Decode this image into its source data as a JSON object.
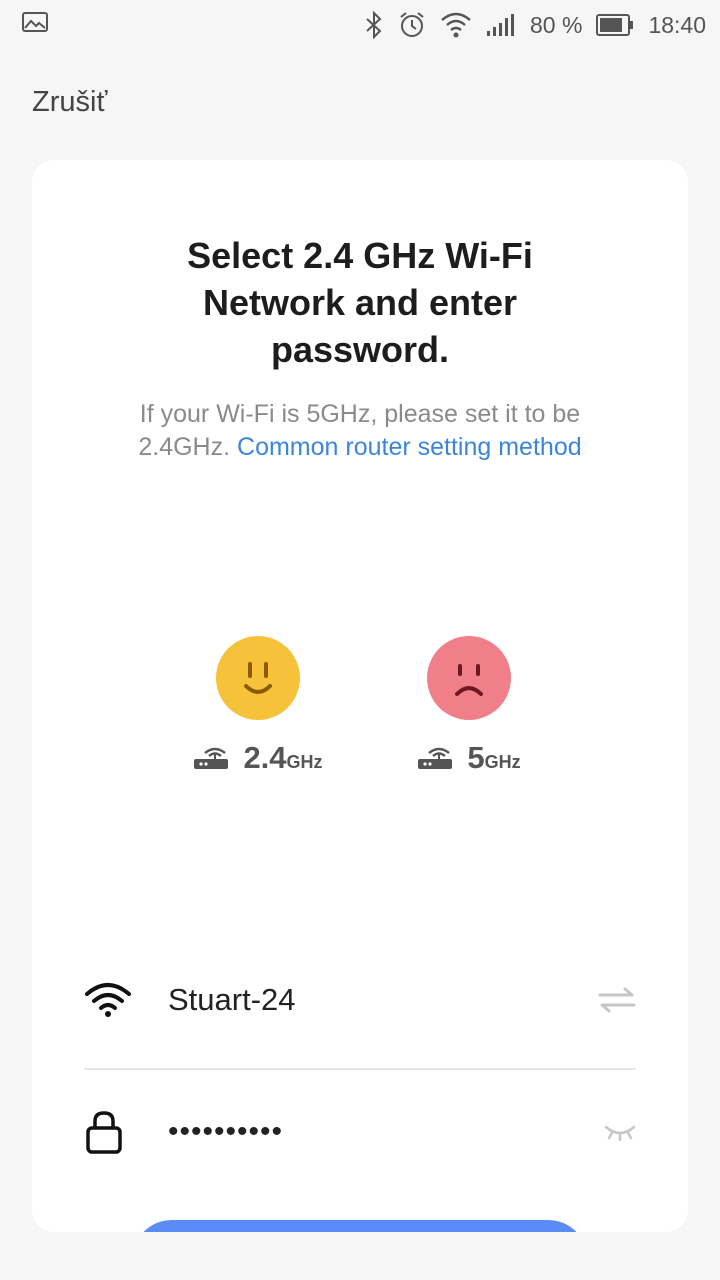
{
  "status_bar": {
    "battery_percent": "80 %",
    "time": "18:40",
    "icons": [
      "image-icon",
      "bluetooth-icon",
      "alarm-icon",
      "wifi-icon",
      "signal-icon",
      "battery-icon"
    ]
  },
  "header": {
    "cancel_label": "Zrušiť"
  },
  "card": {
    "title": "Select 2.4 GHz Wi-Fi Network and enter password.",
    "subtitle_text": "If your Wi-Fi is 5GHz, please set it to be 2.4GHz.",
    "subtitle_link": "Common router setting method"
  },
  "bands": [
    {
      "mood": "happy",
      "big": "2.4",
      "unit": "GHz",
      "color": "#f5c23a"
    },
    {
      "mood": "sad",
      "big": "5",
      "unit": "GHz",
      "color": "#f17f8a"
    }
  ],
  "wifi": {
    "ssid": "Stuart-24",
    "password_masked": "••••••••••"
  },
  "colors": {
    "accent": "#3b86d9",
    "button": "#5b8cf5"
  }
}
